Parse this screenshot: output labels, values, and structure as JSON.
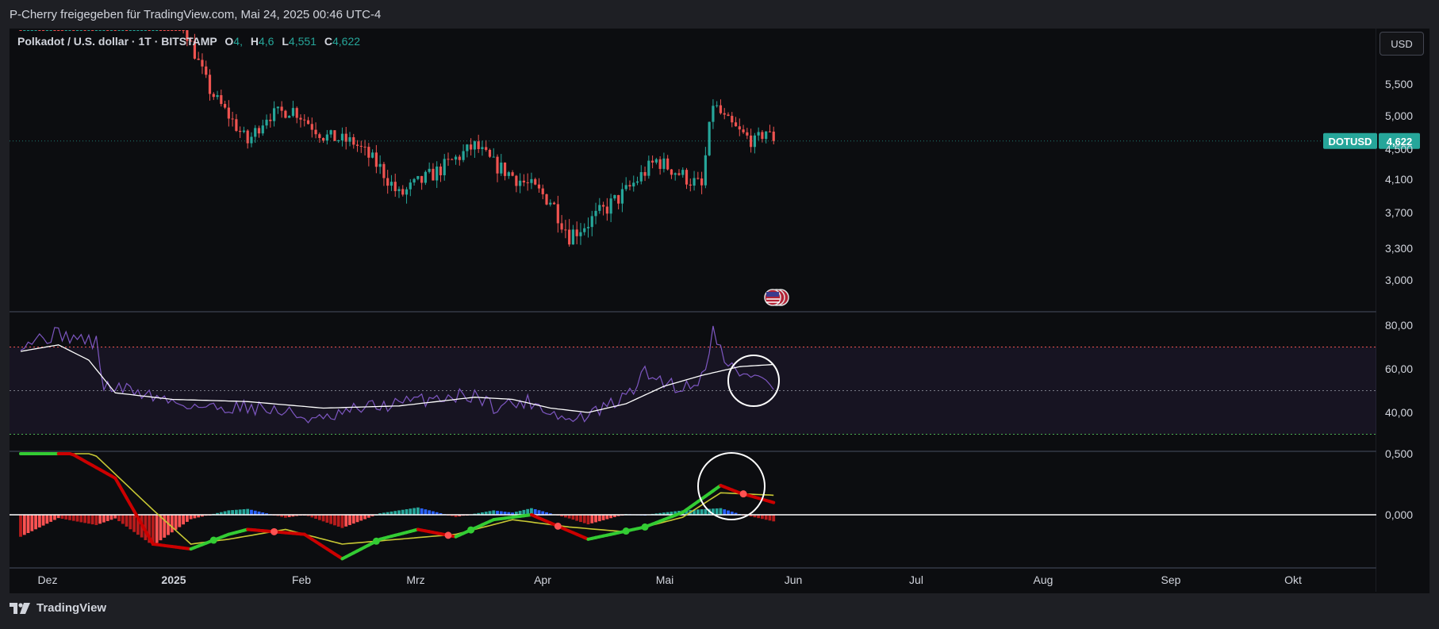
{
  "header": {
    "title": "P-Cherry freigegeben für TradingView.com, Mai 24, 2025 00:46 UTC-4"
  },
  "legend": {
    "symbol": "Polkadot / U.S. dollar · 1T · BITSTAMP",
    "o_label": "O",
    "o_value": "4,",
    "h_label": "H",
    "h_value": "4,6",
    "l_label": "L",
    "l_value": "4,551",
    "c_label": "C",
    "c_value": "4,622"
  },
  "currency_button": "USD",
  "price_tag": {
    "label": "DOTUSD",
    "value": "4,622",
    "color": "#26a69a"
  },
  "footer": {
    "brand": "TradingView"
  },
  "chart_data": [
    {
      "type": "candlestick",
      "panel": "price",
      "series_name": "DOTUSD",
      "x_ticks": [
        "Dez",
        "2025",
        "Feb",
        "Mrz",
        "Apr",
        "Mai",
        "Jun",
        "Jul",
        "Aug",
        "Sep",
        "Okt"
      ],
      "y_ticks": [
        "5,500",
        "5,000",
        "4,500",
        "4,100",
        "3,700",
        "3,300",
        "3,000"
      ],
      "ylim": [
        2.8,
        5.9
      ],
      "colors": {
        "up": "#26a69a",
        "down": "#ef5350"
      },
      "last_price": 4.622,
      "close_anchors": [
        [
          20,
          7.2
        ],
        [
          35,
          7.6
        ],
        [
          50,
          5.4
        ],
        [
          60,
          4.6
        ],
        [
          65,
          5.0
        ],
        [
          72,
          5.1
        ],
        [
          80,
          4.7
        ],
        [
          88,
          4.6
        ],
        [
          95,
          4.25
        ],
        [
          100,
          3.9
        ],
        [
          110,
          4.2
        ],
        [
          120,
          4.55
        ],
        [
          125,
          4.3
        ],
        [
          130,
          4.15
        ],
        [
          140,
          3.85
        ],
        [
          145,
          3.45
        ],
        [
          152,
          3.65
        ],
        [
          160,
          3.95
        ],
        [
          168,
          4.35
        ],
        [
          175,
          4.15
        ],
        [
          180,
          4.0
        ],
        [
          183,
          5.2
        ],
        [
          186,
          4.95
        ],
        [
          190,
          4.75
        ],
        [
          194,
          4.6
        ],
        [
          197,
          4.78
        ],
        [
          199,
          4.622
        ]
      ]
    },
    {
      "type": "line",
      "panel": "rsi",
      "y_ticks": [
        "80,00",
        "60,00",
        "40,00"
      ],
      "ylim": [
        30,
        86
      ],
      "levels": {
        "upper": 70,
        "middle": 50,
        "lower": 30
      },
      "colors": {
        "rsi": "#7e57c2",
        "ma": "#ffffff",
        "upper": "#ef5350",
        "lower": "#4caf50",
        "middle": "#787b86"
      },
      "rsi_anchors": [
        [
          0,
          72
        ],
        [
          10,
          76
        ],
        [
          20,
          72
        ],
        [
          22,
          52
        ],
        [
          30,
          50
        ],
        [
          40,
          45
        ],
        [
          50,
          42
        ],
        [
          60,
          43
        ],
        [
          70,
          40
        ],
        [
          80,
          36
        ],
        [
          90,
          42
        ],
        [
          100,
          44
        ],
        [
          110,
          47
        ],
        [
          120,
          48
        ],
        [
          125,
          43
        ],
        [
          135,
          45
        ],
        [
          145,
          36
        ],
        [
          152,
          40
        ],
        [
          160,
          47
        ],
        [
          165,
          58
        ],
        [
          175,
          51
        ],
        [
          180,
          56
        ],
        [
          183,
          77
        ],
        [
          186,
          66
        ],
        [
          190,
          56
        ],
        [
          195,
          58
        ],
        [
          199,
          50
        ]
      ],
      "ma_anchors": [
        [
          0,
          68
        ],
        [
          10,
          71
        ],
        [
          18,
          64
        ],
        [
          25,
          49
        ],
        [
          40,
          46
        ],
        [
          60,
          45
        ],
        [
          80,
          42
        ],
        [
          100,
          43
        ],
        [
          120,
          47
        ],
        [
          130,
          46
        ],
        [
          140,
          42
        ],
        [
          150,
          40
        ],
        [
          160,
          44
        ],
        [
          170,
          52
        ],
        [
          180,
          57
        ],
        [
          190,
          61
        ],
        [
          199,
          62
        ]
      ]
    },
    {
      "type": "macd",
      "panel": "macd",
      "y_ticks": [
        "0,500",
        "0,000"
      ],
      "ylim": [
        -0.2,
        0.25
      ],
      "colors": {
        "hist_pos_strong": "#26a69a",
        "hist_pos_weak": "#2962ff",
        "hist_neg_strong": "#b71c1c",
        "hist_neg_weak": "#ff5252",
        "macd_up": "#33cc33",
        "macd_down": "#cc0000",
        "signal": "#c8c834",
        "zero": "#ffffff"
      },
      "macd_anchors": [
        [
          0,
          0.25
        ],
        [
          10,
          0.28
        ],
        [
          25,
          0.15
        ],
        [
          35,
          -0.12
        ],
        [
          45,
          -0.14
        ],
        [
          55,
          -0.08
        ],
        [
          60,
          -0.06
        ],
        [
          75,
          -0.08
        ],
        [
          85,
          -0.18
        ],
        [
          95,
          -0.1
        ],
        [
          105,
          -0.06
        ],
        [
          115,
          -0.09
        ],
        [
          125,
          -0.02
        ],
        [
          135,
          0.0
        ],
        [
          150,
          -0.1
        ],
        [
          165,
          -0.05
        ],
        [
          175,
          0.01
        ],
        [
          185,
          0.12
        ],
        [
          190,
          0.09
        ],
        [
          199,
          0.05
        ]
      ],
      "signal_anchors": [
        [
          0,
          0.35
        ],
        [
          20,
          0.24
        ],
        [
          35,
          0.02
        ],
        [
          45,
          -0.12
        ],
        [
          55,
          -0.1
        ],
        [
          70,
          -0.06
        ],
        [
          85,
          -0.12
        ],
        [
          100,
          -0.1
        ],
        [
          115,
          -0.08
        ],
        [
          130,
          -0.02
        ],
        [
          145,
          -0.05
        ],
        [
          160,
          -0.07
        ],
        [
          175,
          -0.01
        ],
        [
          185,
          0.09
        ],
        [
          199,
          0.08
        ]
      ]
    }
  ],
  "annotations": {
    "event_badge": "us-flag-icon"
  }
}
